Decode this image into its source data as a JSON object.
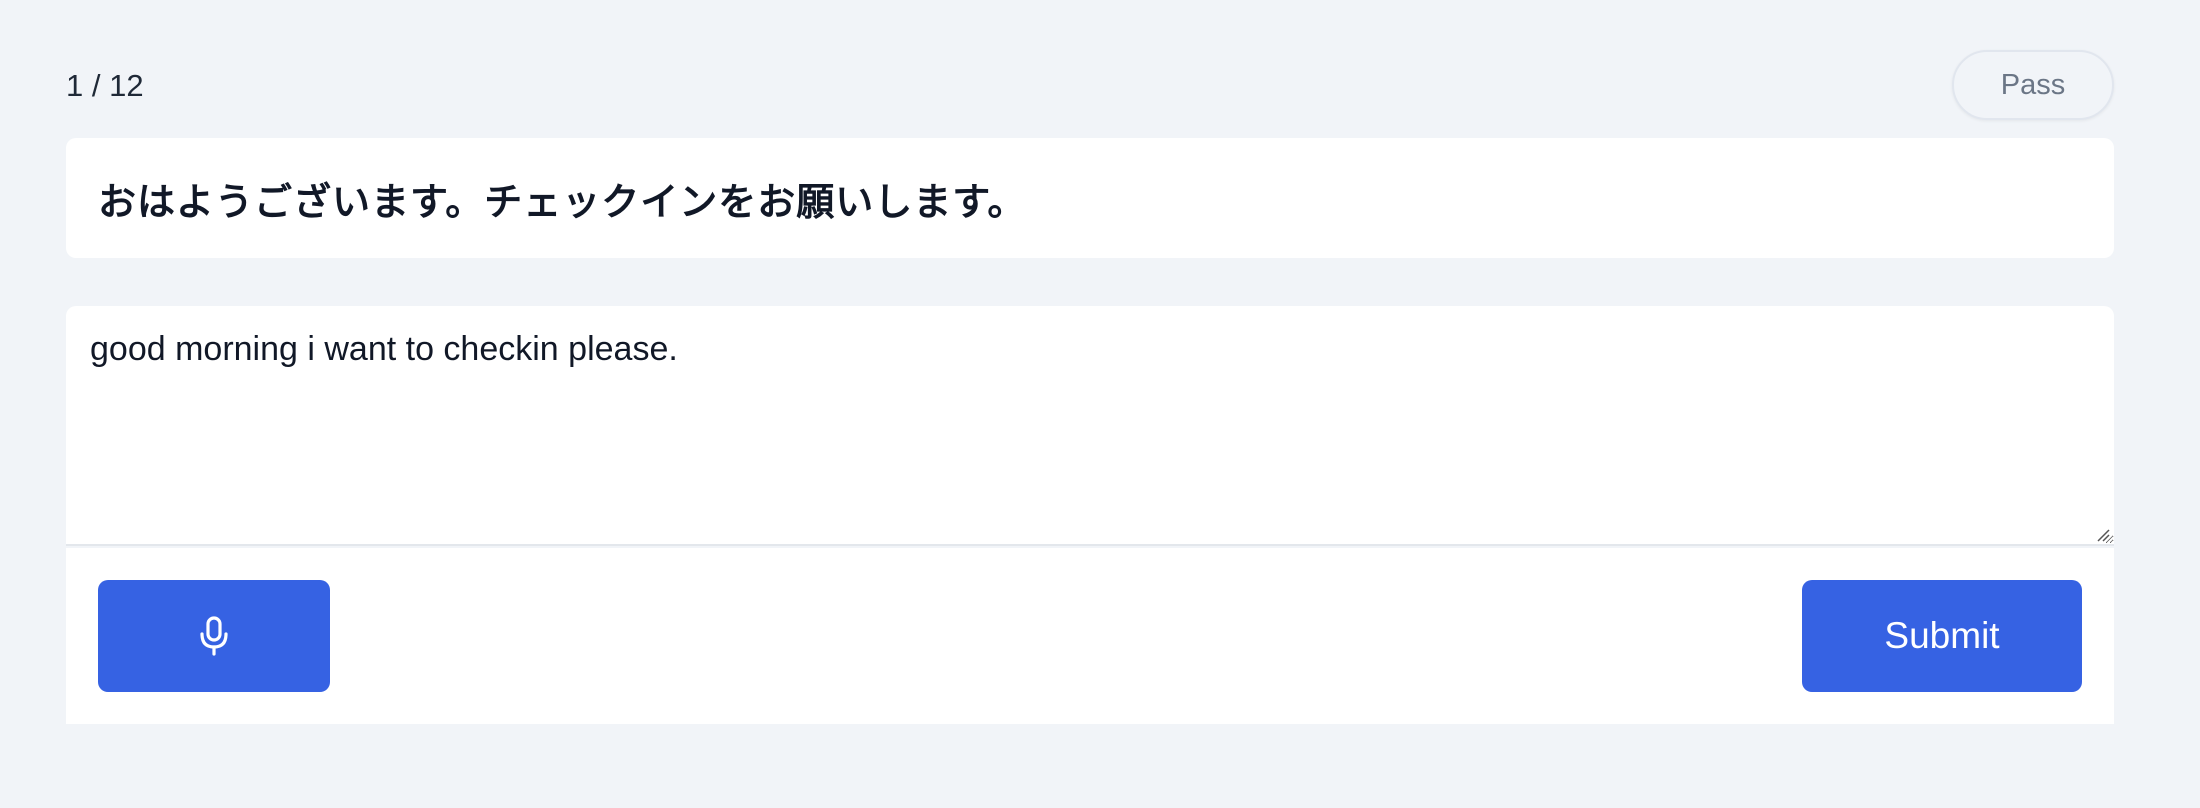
{
  "header": {
    "progress": "1 / 12",
    "pass_label": "Pass"
  },
  "prompt": {
    "text": "おはようございます。チェックインをお願いします。"
  },
  "answer": {
    "value": "good morning i want to checkin please.",
    "placeholder": ""
  },
  "actions": {
    "mic_icon": "microphone-icon",
    "submit_label": "Submit"
  },
  "colors": {
    "background": "#f1f4f8",
    "accent": "#3662e3",
    "card": "#ffffff",
    "muted_text": "#6b7686"
  }
}
